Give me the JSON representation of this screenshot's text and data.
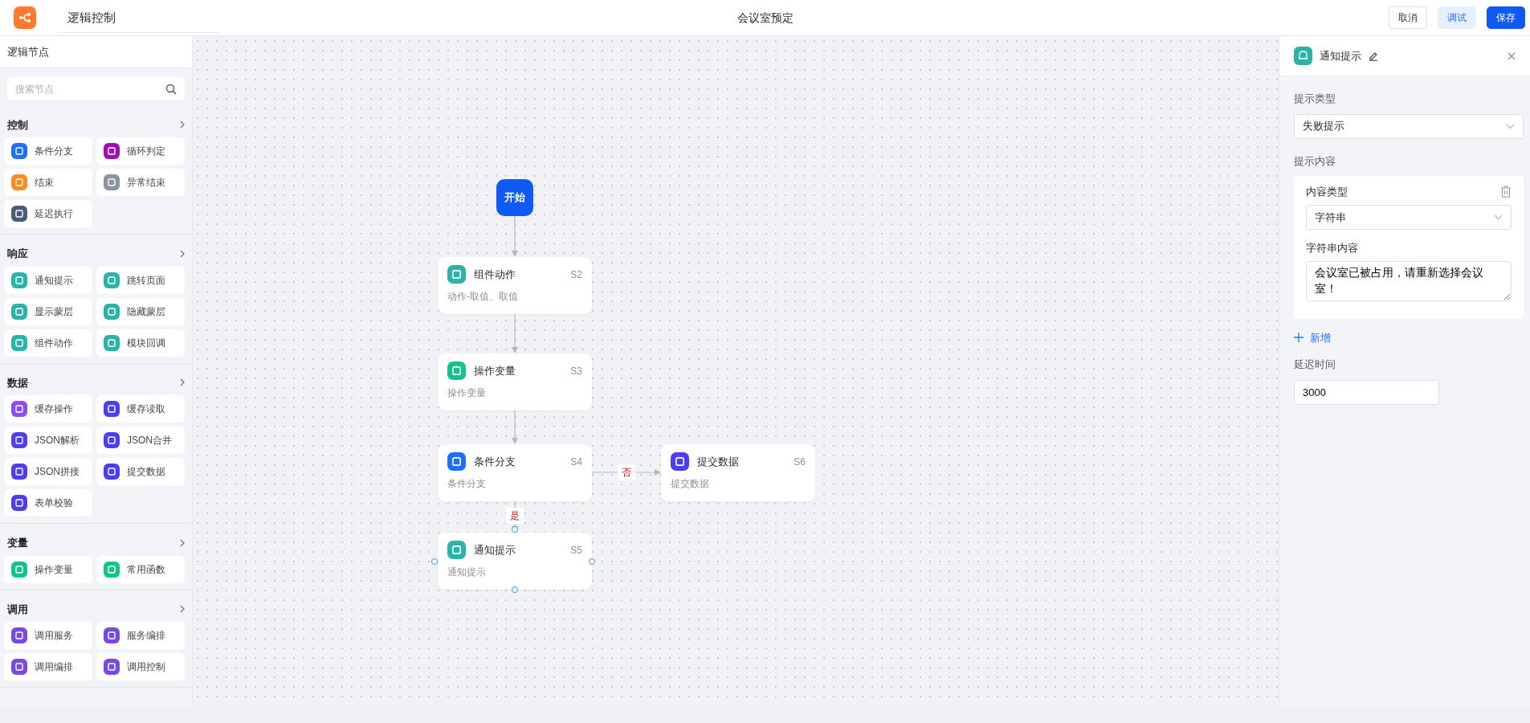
{
  "app": {
    "title": "逻辑控制",
    "page_title": "会议室预定",
    "buttons": [
      {
        "label": "取消",
        "kind": "outline"
      },
      {
        "label": "调试",
        "kind": "light"
      },
      {
        "label": "保存",
        "kind": "primary"
      }
    ]
  },
  "sidebar": {
    "title": "逻辑节点",
    "search": {
      "placeholder": "搜索节点"
    },
    "sections": [
      {
        "title": "控制",
        "items": [
          {
            "label": "条件分支",
            "color": "#1e6fff"
          },
          {
            "label": "循环判定",
            "color": "#a00fb0"
          },
          {
            "label": "结束",
            "color": "#ff8a1f"
          },
          {
            "label": "异常结束",
            "color": "#8c939d"
          },
          {
            "label": "延迟执行",
            "color": "#4a5b7c"
          }
        ]
      },
      {
        "title": "响应",
        "items": [
          {
            "label": "通知提示",
            "color": "#2bb3a8"
          },
          {
            "label": "跳转页面",
            "color": "#2bb3a8"
          },
          {
            "label": "显示蒙层",
            "color": "#2bb3a8"
          },
          {
            "label": "隐藏蒙层",
            "color": "#2bb3a8"
          },
          {
            "label": "组件动作",
            "color": "#2bb3a8"
          },
          {
            "label": "模块回调",
            "color": "#2bb3a8"
          }
        ]
      },
      {
        "title": "数据",
        "items": [
          {
            "label": "缓存操作",
            "color": "#8b4cf0"
          },
          {
            "label": "缓存读取",
            "color": "#4d3df0"
          },
          {
            "label": "JSON解析",
            "color": "#4d3df0"
          },
          {
            "label": "JSON合并",
            "color": "#4d3df0"
          },
          {
            "label": "JSON拼接",
            "color": "#4d3df0"
          },
          {
            "label": "提交数据",
            "color": "#4d3df0"
          },
          {
            "label": "表单校验",
            "color": "#4d3df0"
          }
        ]
      },
      {
        "title": "变量",
        "items": [
          {
            "label": "操作变量",
            "color": "#12c48b"
          },
          {
            "label": "常用函数",
            "color": "#12c48b"
          }
        ]
      },
      {
        "title": "调用",
        "items": [
          {
            "label": "调用服务",
            "color": "#7a4ae0"
          },
          {
            "label": "服务编排",
            "color": "#7a4ae0"
          },
          {
            "label": "调用编排",
            "color": "#7a4ae0"
          },
          {
            "label": "调用控制",
            "color": "#7a4ae0"
          }
        ]
      }
    ]
  },
  "canvas": {
    "start": {
      "label": "开始"
    },
    "nodes": [
      {
        "title": "组件动作",
        "id": "S2",
        "subtitle": "动作-取值、取值",
        "color": "#2bb3a8",
        "selected": false
      },
      {
        "title": "操作变量",
        "id": "S3",
        "subtitle": "操作变量",
        "color": "#12c48b",
        "selected": false
      },
      {
        "title": "条件分支",
        "id": "S4",
        "subtitle": "条件分支",
        "color": "#1e6fff",
        "selected": false
      },
      {
        "title": "提交数据",
        "id": "S6",
        "subtitle": "提交数据",
        "color": "#4d3df0",
        "selected": false
      },
      {
        "title": "通知提示",
        "id": "S5",
        "subtitle": "通知提示",
        "color": "#2bb3a8",
        "selected": true
      }
    ],
    "edge_labels": [
      "否",
      "是"
    ]
  },
  "panel": {
    "title": "通知提示",
    "prompt_type": {
      "label": "提示类型",
      "value": "失败提示"
    },
    "content_label": "提示内容",
    "content_items": [
      {
        "type_label": "内容类型",
        "type_value": "字符串",
        "text_label": "字符串内容",
        "text": "会议室已被占用，请重新选择会议室！"
      }
    ],
    "add_label": "新增",
    "delay": {
      "label": "延迟时间",
      "value": "3000"
    }
  }
}
